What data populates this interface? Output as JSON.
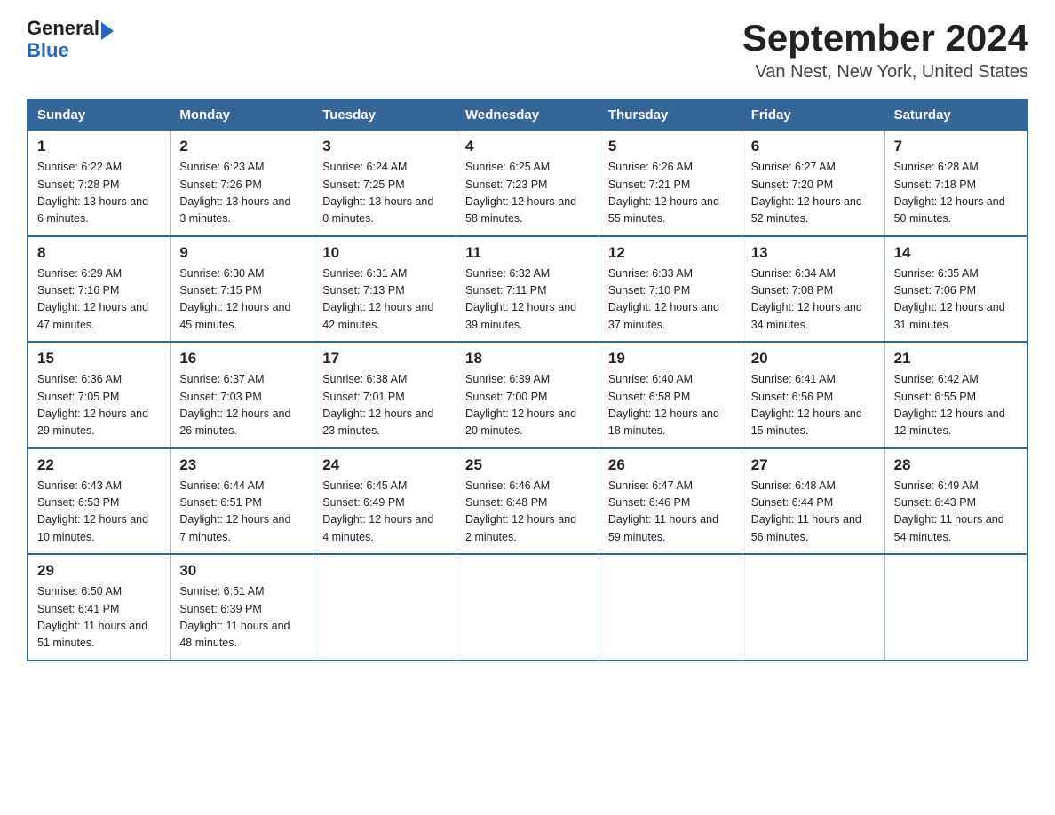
{
  "header": {
    "logo_general": "General",
    "logo_blue": "Blue",
    "title": "September 2024",
    "subtitle": "Van Nest, New York, United States"
  },
  "weekdays": [
    "Sunday",
    "Monday",
    "Tuesday",
    "Wednesday",
    "Thursday",
    "Friday",
    "Saturday"
  ],
  "weeks": [
    [
      {
        "day": "1",
        "sunrise": "6:22 AM",
        "sunset": "7:28 PM",
        "daylight": "13 hours and 6 minutes."
      },
      {
        "day": "2",
        "sunrise": "6:23 AM",
        "sunset": "7:26 PM",
        "daylight": "13 hours and 3 minutes."
      },
      {
        "day": "3",
        "sunrise": "6:24 AM",
        "sunset": "7:25 PM",
        "daylight": "13 hours and 0 minutes."
      },
      {
        "day": "4",
        "sunrise": "6:25 AM",
        "sunset": "7:23 PM",
        "daylight": "12 hours and 58 minutes."
      },
      {
        "day": "5",
        "sunrise": "6:26 AM",
        "sunset": "7:21 PM",
        "daylight": "12 hours and 55 minutes."
      },
      {
        "day": "6",
        "sunrise": "6:27 AM",
        "sunset": "7:20 PM",
        "daylight": "12 hours and 52 minutes."
      },
      {
        "day": "7",
        "sunrise": "6:28 AM",
        "sunset": "7:18 PM",
        "daylight": "12 hours and 50 minutes."
      }
    ],
    [
      {
        "day": "8",
        "sunrise": "6:29 AM",
        "sunset": "7:16 PM",
        "daylight": "12 hours and 47 minutes."
      },
      {
        "day": "9",
        "sunrise": "6:30 AM",
        "sunset": "7:15 PM",
        "daylight": "12 hours and 45 minutes."
      },
      {
        "day": "10",
        "sunrise": "6:31 AM",
        "sunset": "7:13 PM",
        "daylight": "12 hours and 42 minutes."
      },
      {
        "day": "11",
        "sunrise": "6:32 AM",
        "sunset": "7:11 PM",
        "daylight": "12 hours and 39 minutes."
      },
      {
        "day": "12",
        "sunrise": "6:33 AM",
        "sunset": "7:10 PM",
        "daylight": "12 hours and 37 minutes."
      },
      {
        "day": "13",
        "sunrise": "6:34 AM",
        "sunset": "7:08 PM",
        "daylight": "12 hours and 34 minutes."
      },
      {
        "day": "14",
        "sunrise": "6:35 AM",
        "sunset": "7:06 PM",
        "daylight": "12 hours and 31 minutes."
      }
    ],
    [
      {
        "day": "15",
        "sunrise": "6:36 AM",
        "sunset": "7:05 PM",
        "daylight": "12 hours and 29 minutes."
      },
      {
        "day": "16",
        "sunrise": "6:37 AM",
        "sunset": "7:03 PM",
        "daylight": "12 hours and 26 minutes."
      },
      {
        "day": "17",
        "sunrise": "6:38 AM",
        "sunset": "7:01 PM",
        "daylight": "12 hours and 23 minutes."
      },
      {
        "day": "18",
        "sunrise": "6:39 AM",
        "sunset": "7:00 PM",
        "daylight": "12 hours and 20 minutes."
      },
      {
        "day": "19",
        "sunrise": "6:40 AM",
        "sunset": "6:58 PM",
        "daylight": "12 hours and 18 minutes."
      },
      {
        "day": "20",
        "sunrise": "6:41 AM",
        "sunset": "6:56 PM",
        "daylight": "12 hours and 15 minutes."
      },
      {
        "day": "21",
        "sunrise": "6:42 AM",
        "sunset": "6:55 PM",
        "daylight": "12 hours and 12 minutes."
      }
    ],
    [
      {
        "day": "22",
        "sunrise": "6:43 AM",
        "sunset": "6:53 PM",
        "daylight": "12 hours and 10 minutes."
      },
      {
        "day": "23",
        "sunrise": "6:44 AM",
        "sunset": "6:51 PM",
        "daylight": "12 hours and 7 minutes."
      },
      {
        "day": "24",
        "sunrise": "6:45 AM",
        "sunset": "6:49 PM",
        "daylight": "12 hours and 4 minutes."
      },
      {
        "day": "25",
        "sunrise": "6:46 AM",
        "sunset": "6:48 PM",
        "daylight": "12 hours and 2 minutes."
      },
      {
        "day": "26",
        "sunrise": "6:47 AM",
        "sunset": "6:46 PM",
        "daylight": "11 hours and 59 minutes."
      },
      {
        "day": "27",
        "sunrise": "6:48 AM",
        "sunset": "6:44 PM",
        "daylight": "11 hours and 56 minutes."
      },
      {
        "day": "28",
        "sunrise": "6:49 AM",
        "sunset": "6:43 PM",
        "daylight": "11 hours and 54 minutes."
      }
    ],
    [
      {
        "day": "29",
        "sunrise": "6:50 AM",
        "sunset": "6:41 PM",
        "daylight": "11 hours and 51 minutes."
      },
      {
        "day": "30",
        "sunrise": "6:51 AM",
        "sunset": "6:39 PM",
        "daylight": "11 hours and 48 minutes."
      },
      null,
      null,
      null,
      null,
      null
    ]
  ],
  "labels": {
    "sunrise": "Sunrise:",
    "sunset": "Sunset:",
    "daylight": "Daylight:"
  }
}
